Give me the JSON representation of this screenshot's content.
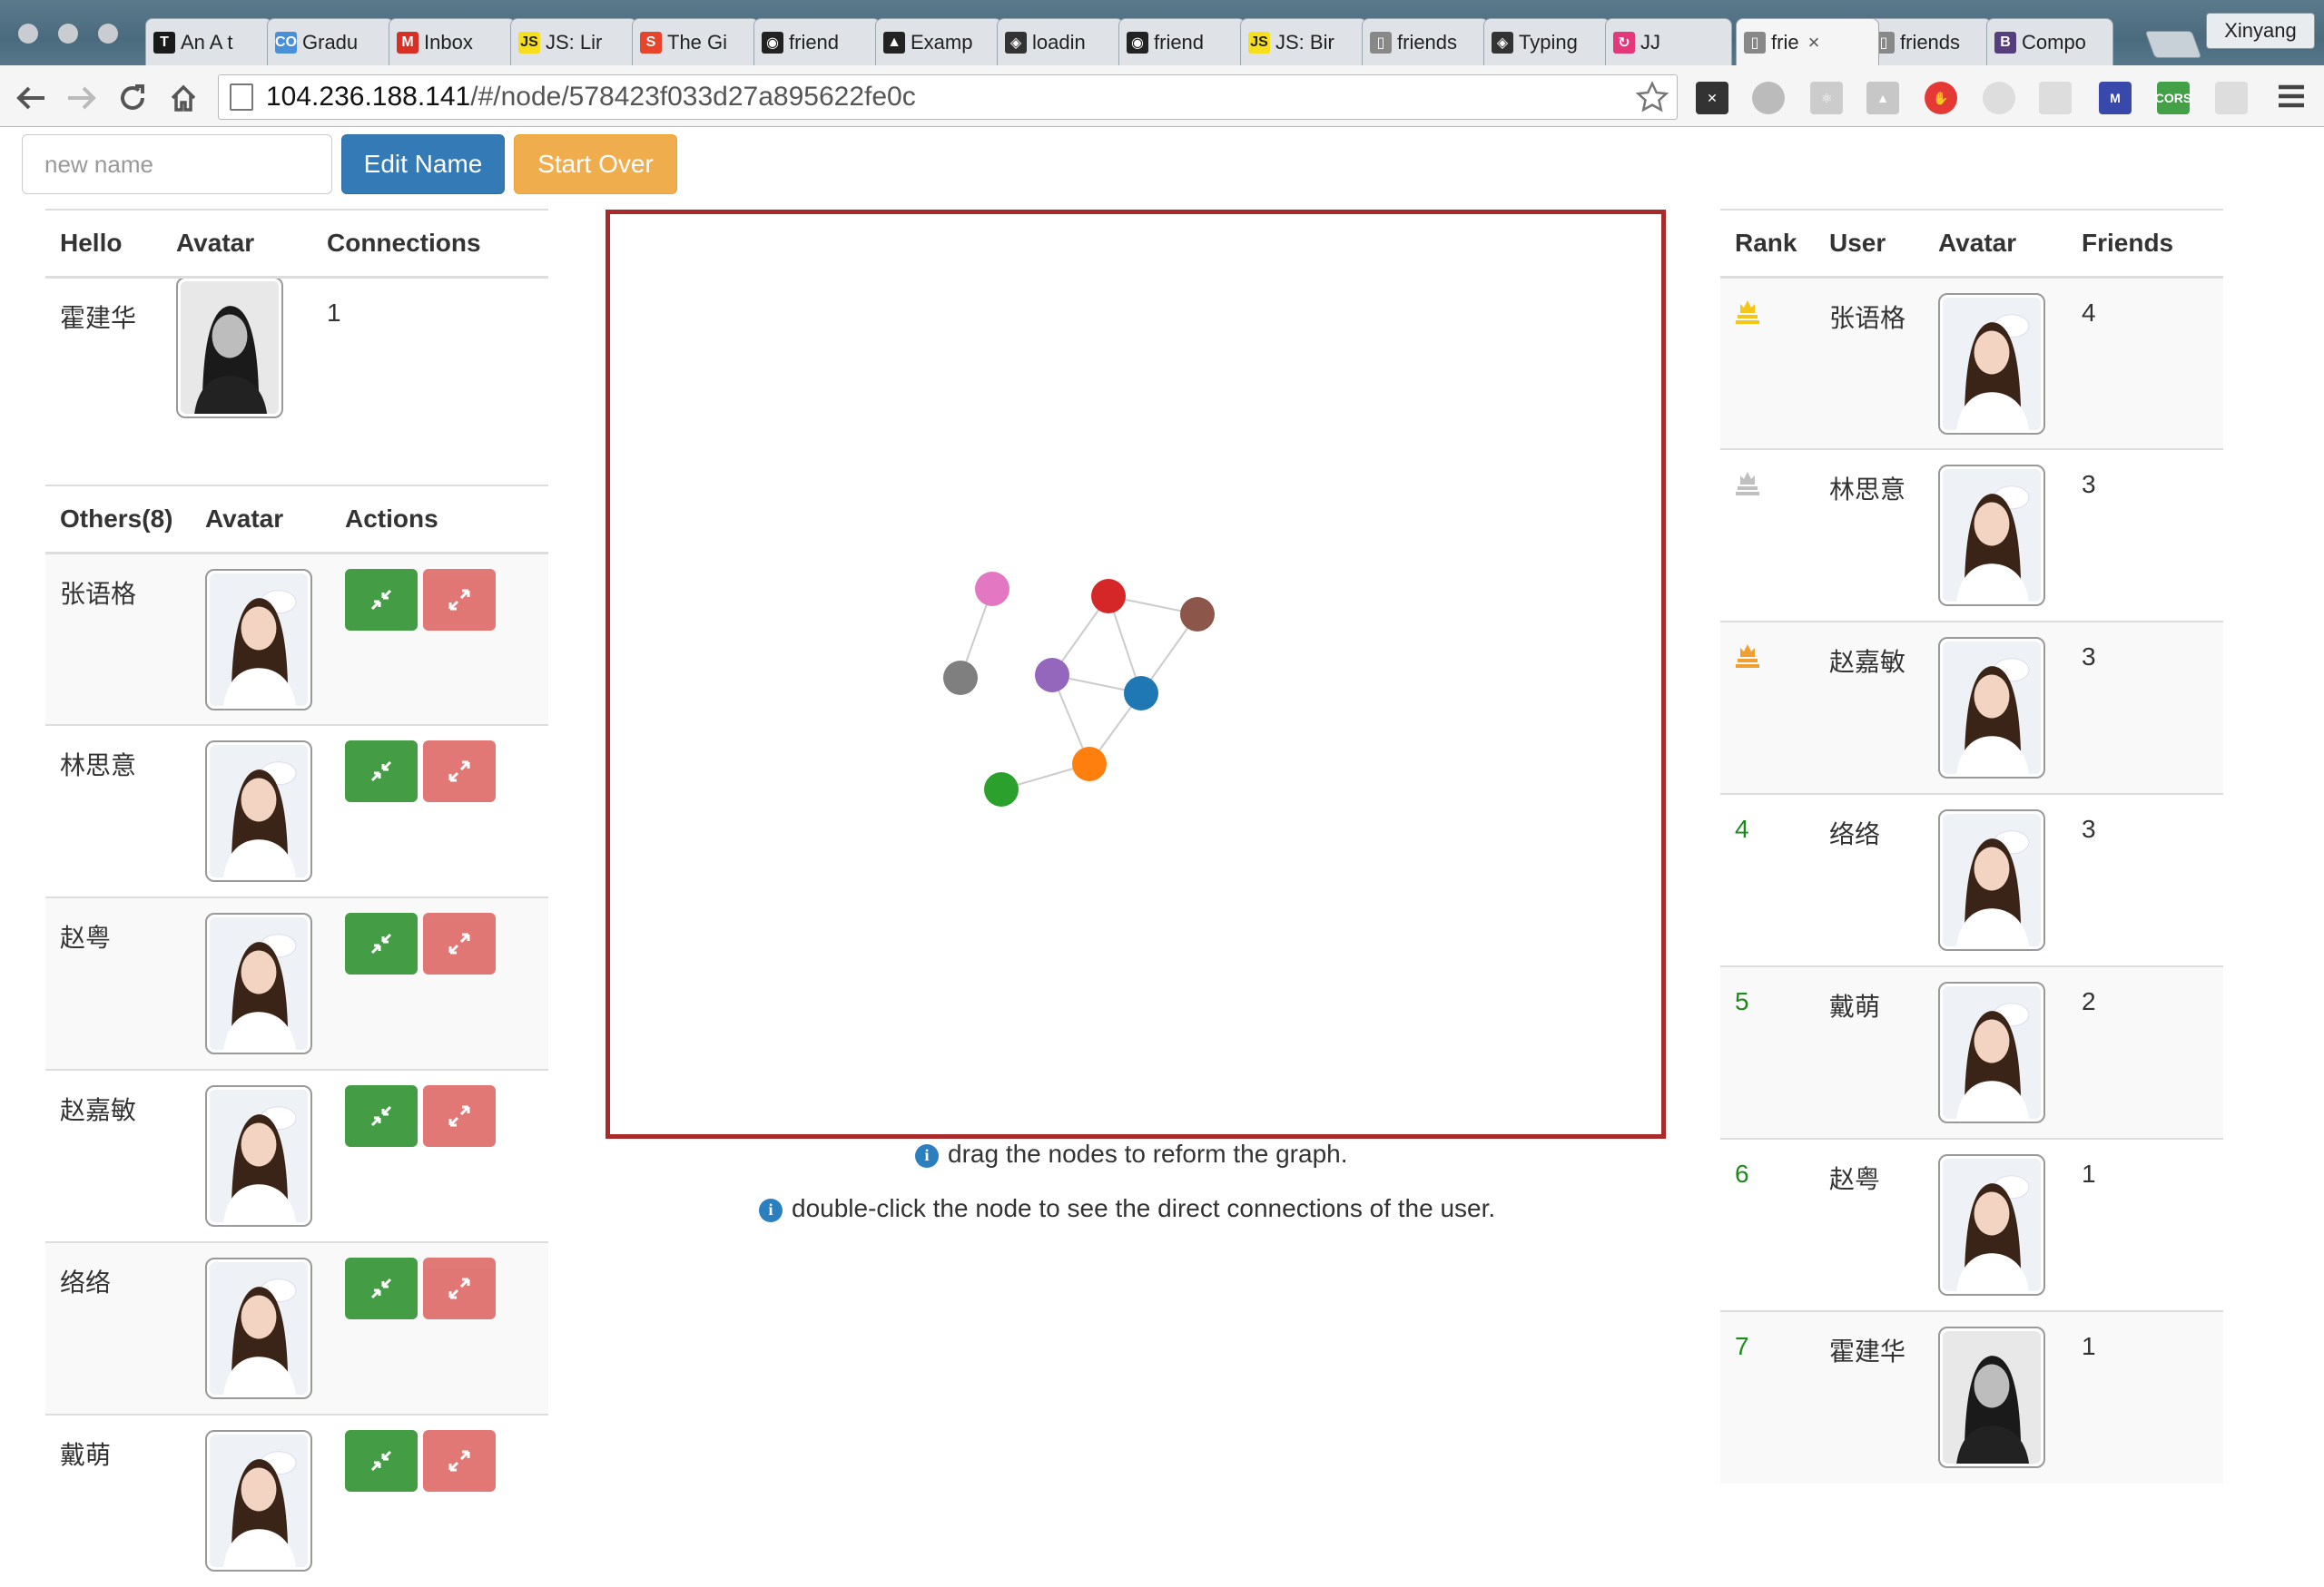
{
  "browser": {
    "tabs": [
      {
        "label": "An A t",
        "icon_color": "#1a1a1a",
        "icon_text": "T"
      },
      {
        "label": "Gradu",
        "icon_color": "#4a90d9",
        "icon_text": "CO"
      },
      {
        "label": "Inbox",
        "icon_color": "#d93025",
        "icon_text": "M"
      },
      {
        "label": "JS: Lir",
        "icon_color": "#f7df1e",
        "icon_text": "JS"
      },
      {
        "label": "The Gi",
        "icon_color": "#e8442b",
        "icon_text": "S"
      },
      {
        "label": "friend",
        "icon_color": "#222222",
        "icon_text": "◉"
      },
      {
        "label": "Examp",
        "icon_color": "#222222",
        "icon_text": "▲"
      },
      {
        "label": "loadin",
        "icon_color": "#333333",
        "icon_text": "◈"
      },
      {
        "label": "friend",
        "icon_color": "#222222",
        "icon_text": "◉"
      },
      {
        "label": "JS: Bir",
        "icon_color": "#f7df1e",
        "icon_text": "JS"
      },
      {
        "label": "friends",
        "icon_color": "#888888",
        "icon_text": "▯"
      },
      {
        "label": "Typing",
        "icon_color": "#333333",
        "icon_text": "◈"
      },
      {
        "label": "JJ",
        "icon_color": "#e4387a",
        "icon_text": "↻"
      },
      {
        "label": "frie",
        "icon_color": "#888888",
        "icon_text": "▯",
        "active": true,
        "close": "×"
      },
      {
        "label": "friends",
        "icon_color": "#888888",
        "icon_text": "▯"
      },
      {
        "label": "Compo",
        "icon_color": "#563d7c",
        "icon_text": "B"
      }
    ],
    "profile_name": "Xinyang",
    "url_host": "104.236.188.141",
    "url_path": "/#/node/578423f033d27a895622fe0c"
  },
  "controls": {
    "name_placeholder": "new name",
    "edit_name_label": "Edit Name",
    "start_over_label": "Start Over"
  },
  "me_table": {
    "headers": [
      "Hello",
      "Avatar",
      "Connections"
    ],
    "name": "霍建华",
    "connections": "1"
  },
  "others_table": {
    "headers": [
      "Others(8)",
      "Avatar",
      "Actions"
    ],
    "rows": [
      {
        "name": "张语格"
      },
      {
        "name": "林思意"
      },
      {
        "name": "赵粤"
      },
      {
        "name": "赵嘉敏"
      },
      {
        "name": "络络"
      },
      {
        "name": "戴萌"
      }
    ]
  },
  "graph": {
    "nodes": [
      {
        "id": "pink",
        "color": "#e377c2"
      },
      {
        "id": "gray",
        "color": "#7f7f7f"
      },
      {
        "id": "red",
        "color": "#d62728"
      },
      {
        "id": "brown",
        "color": "#8c564b"
      },
      {
        "id": "purple",
        "color": "#9467bd"
      },
      {
        "id": "blue",
        "color": "#1f77b4"
      },
      {
        "id": "orange",
        "color": "#ff7f0e"
      },
      {
        "id": "green",
        "color": "#2ca02c"
      }
    ],
    "links": [
      [
        "pink",
        "gray"
      ],
      [
        "red",
        "brown"
      ],
      [
        "red",
        "purple"
      ],
      [
        "red",
        "blue"
      ],
      [
        "brown",
        "blue"
      ],
      [
        "purple",
        "blue"
      ],
      [
        "purple",
        "orange"
      ],
      [
        "blue",
        "orange"
      ],
      [
        "orange",
        "green"
      ]
    ],
    "edge_color": "#cccccc"
  },
  "hints": {
    "drag": "drag the nodes to reform the graph.",
    "dblclick": "double-click the node to see the direct connections of the user.",
    "icon": "i"
  },
  "rank_table": {
    "headers": [
      "Rank",
      "User",
      "Avatar",
      "Friends"
    ],
    "rows": [
      {
        "rank": "",
        "medal": "gold",
        "medal_color": "#f5c518",
        "user": "张语格",
        "friends": "4"
      },
      {
        "rank": "",
        "medal": "silver",
        "medal_color": "#c0c0c0",
        "user": "林思意",
        "friends": "3"
      },
      {
        "rank": "",
        "medal": "bronze",
        "medal_color": "#f0a030",
        "user": "赵嘉敏",
        "friends": "3"
      },
      {
        "rank": "4",
        "user": "络络",
        "friends": "3"
      },
      {
        "rank": "5",
        "user": "戴萌",
        "friends": "2"
      },
      {
        "rank": "6",
        "user": "赵粤",
        "friends": "1"
      },
      {
        "rank": "7",
        "user": "霍建华",
        "friends": "1"
      }
    ]
  }
}
